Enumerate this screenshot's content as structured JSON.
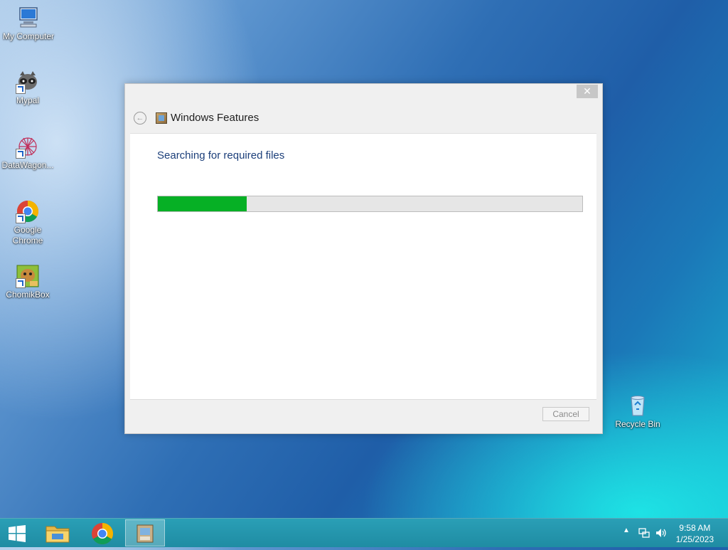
{
  "desktop": {
    "icons": [
      {
        "label": "My Computer"
      },
      {
        "label": "Mypal"
      },
      {
        "label": "DataWagon..."
      },
      {
        "label": "Google Chrome"
      },
      {
        "label": "ChomikBox"
      },
      {
        "label": "Recycle Bin"
      }
    ]
  },
  "dialog": {
    "title": "Windows Features",
    "close_glyph": "✕",
    "back_glyph": "←",
    "status": "Searching for required files",
    "progress_fraction": 0.21,
    "cancel_label": "Cancel"
  },
  "taskbar": {
    "icons": [
      "windows-start-icon",
      "file-explorer-icon",
      "chrome-icon",
      "windows-features-icon"
    ],
    "tray_icons": [
      "show-hidden-icons-arrow",
      "network-icon",
      "volume-icon"
    ],
    "time": "9:58 AM",
    "date": "1/25/2023"
  },
  "colors": {
    "progress_fill": "#06b025",
    "status_text": "#1c3f7a",
    "taskbar": "#1f8ca3"
  }
}
